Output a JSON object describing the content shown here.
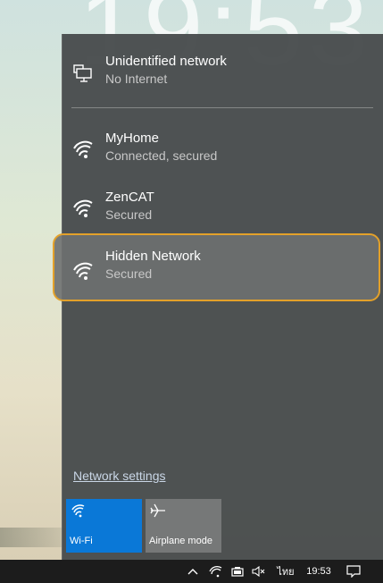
{
  "background": {
    "clock_text": "19:53"
  },
  "flyout": {
    "networks": [
      {
        "name": "Unidentified network",
        "status": "No Internet",
        "icon": "wired-network-icon"
      },
      {
        "name": "MyHome",
        "status": "Connected, secured",
        "icon": "wifi-signal-icon"
      },
      {
        "name": "ZenCAT",
        "status": "Secured",
        "icon": "wifi-signal-icon"
      },
      {
        "name": "Hidden Network",
        "status": "Secured",
        "icon": "wifi-signal-icon",
        "highlighted": true,
        "highlight_color": "#e3a12a"
      }
    ],
    "settings_link": "Network settings",
    "quick_actions": [
      {
        "label": "Wi-Fi",
        "icon": "wifi-icon",
        "active": true,
        "color": "#0a78d7"
      },
      {
        "label": "Airplane mode",
        "icon": "airplane-icon",
        "active": false
      }
    ]
  },
  "taskbar": {
    "tray_icons": [
      "chevron-up-icon",
      "wifi-icon",
      "battery-icon",
      "volume-muted-icon"
    ],
    "language": "ไทย",
    "time": "19:53",
    "notification_icon": "action-center-icon"
  }
}
